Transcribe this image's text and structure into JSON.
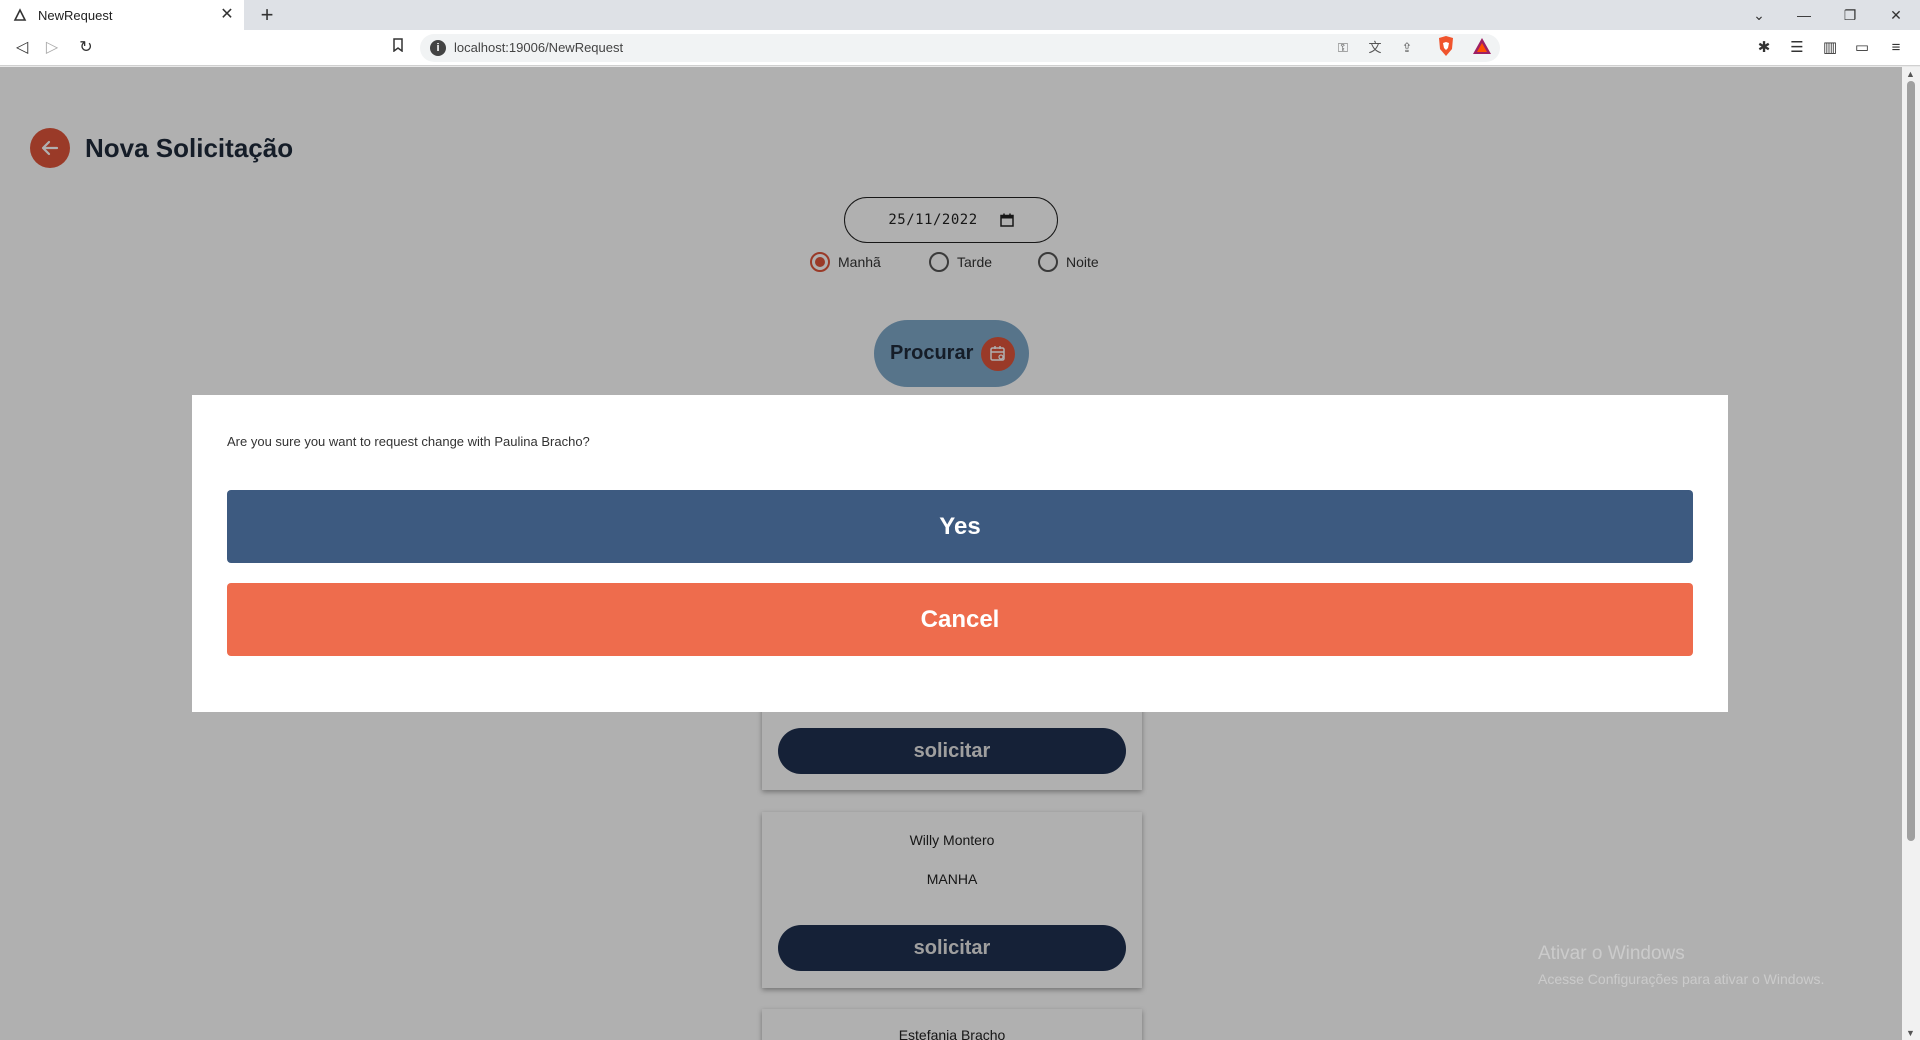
{
  "browser": {
    "tab_title": "NewRequest",
    "url": "localhost:19006/NewRequest"
  },
  "page": {
    "title": "Nova Solicitação",
    "date_value": "25/11/2022",
    "shifts": [
      {
        "label": "Manhã",
        "checked": true
      },
      {
        "label": "Tarde",
        "checked": false
      },
      {
        "label": "Noite",
        "checked": false
      }
    ],
    "search_label": "Procurar",
    "cards": [
      {
        "name": "",
        "shift": "",
        "button": "solicitar"
      },
      {
        "name": "Willy Montero",
        "shift": "MANHA",
        "button": "solicitar"
      },
      {
        "name": "Estefania Bracho",
        "shift": "",
        "button": ""
      }
    ]
  },
  "modal": {
    "message": "Are you sure you want to request change with Paulina Bracho?",
    "yes_label": "Yes",
    "cancel_label": "Cancel"
  },
  "watermark": {
    "line1": "Ativar o Windows",
    "line2": "Acesse Configurações para ativar o Windows."
  },
  "colors": {
    "accent": "#e0553a",
    "yes_button": "#3d5a80",
    "cancel_button": "#ee6c4d",
    "solicitar_button": "#1f3050",
    "search_button": "#7fa8c9"
  }
}
